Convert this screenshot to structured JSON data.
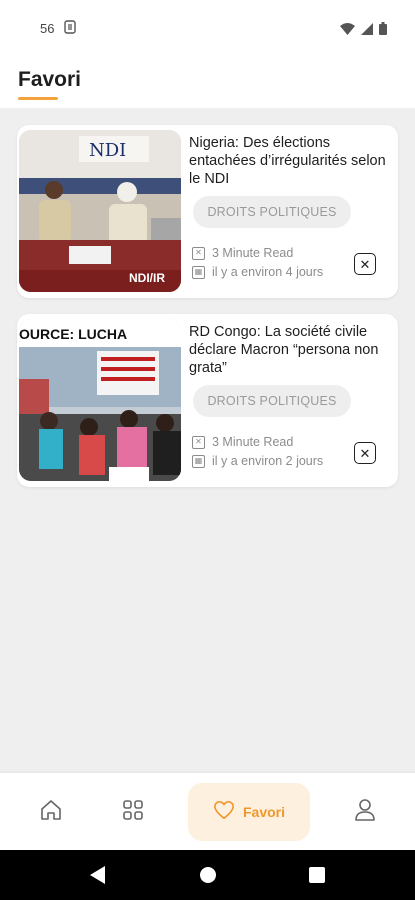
{
  "status_bar": {
    "time_fragment": "56",
    "notification_icon": "s-notification-icon",
    "icons": [
      "wifi-icon",
      "signal-icon",
      "battery-icon"
    ]
  },
  "header": {
    "title": "Favori",
    "accent_color": "#f4a23c"
  },
  "favorites": [
    {
      "title": "Nigeria: Des élections entachées d’irrégularités selon le NDI",
      "tag": "DROITS POLITIQUES",
      "read_time": "3 Minute Read",
      "posted": "il y a environ 4 jours",
      "image_text": "NDI/IR",
      "image_banner": "NDI"
    },
    {
      "title": "RD Congo: La société civile déclare Macron “persona non grata”",
      "tag": "DROITS POLITIQUES",
      "read_time": "3 Minute Read",
      "posted": "il y a environ 2 jours",
      "image_text": "OURCE: LUCHA"
    }
  ],
  "bottom_nav": {
    "items": [
      {
        "name": "home",
        "icon": "home-icon"
      },
      {
        "name": "categories",
        "icon": "grid-icon"
      },
      {
        "name": "favori",
        "icon": "heart-icon",
        "label": "Favori",
        "active": true
      },
      {
        "name": "profile",
        "icon": "user-icon"
      }
    ],
    "active_color": "#f0972d"
  },
  "system_nav": [
    "back-icon",
    "home-circle-icon",
    "recents-icon"
  ]
}
